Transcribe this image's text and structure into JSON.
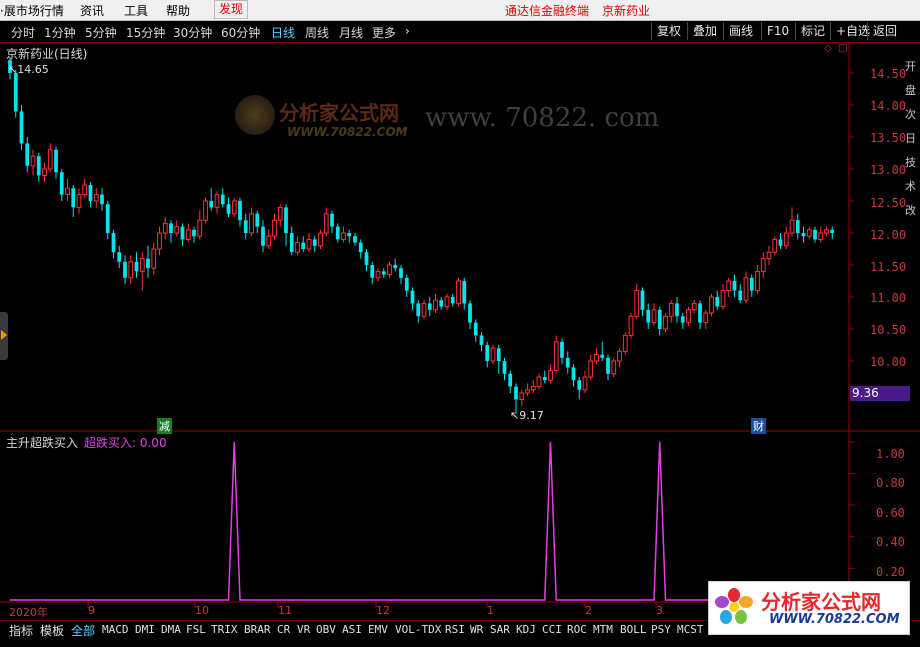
{
  "menubar": {
    "items": [
      "·展市场行情",
      "资讯",
      "工具",
      "帮助"
    ],
    "discover": "发现",
    "center_title": "通达信金融终端",
    "stock_title": "京新药业"
  },
  "toolbar": {
    "periods": [
      "分时",
      "1分钟",
      "5分钟",
      "15分钟",
      "30分钟",
      "60分钟",
      "日线",
      "周线",
      "月线",
      "更多",
      "›"
    ],
    "active_period": "日线",
    "right_buttons": [
      "复权",
      "叠加",
      "画线",
      "F10",
      "标记",
      "+自选",
      "返回"
    ]
  },
  "main_chart": {
    "stock_label": "京新药业(日线)",
    "high_marker": "14.65",
    "low_marker": "9.17",
    "current_price": "9.36",
    "badge_left": "减",
    "badge_right": "财",
    "side_text": "开 盘 次 日 技 术 改",
    "y_ticks": [
      "14.50",
      "14.00",
      "13.50",
      "13.00",
      "12.50",
      "12.00",
      "11.50",
      "11.00",
      "10.50",
      "10.00"
    ]
  },
  "watermark": {
    "logo_text": "分析家公式网",
    "logo_url": "WWW.70822.COM",
    "url_text": "www. 70822. com"
  },
  "indicator": {
    "name": "主升超跌买入",
    "series_label": "超跌买入: 0.00",
    "y_ticks": [
      "1.00",
      "0.80",
      "0.60",
      "0.40",
      "0.20"
    ]
  },
  "x_axis": {
    "labels": [
      "2020年",
      "9",
      "10",
      "11",
      "12",
      "1",
      "2",
      "3"
    ]
  },
  "bottom_tabs": {
    "items": [
      "指标",
      "模板",
      "全部",
      "MACD",
      "DMI",
      "DMA",
      "FSL",
      "TRIX",
      "BRAR",
      "CR",
      "VR",
      "OBV",
      "ASI",
      "EMV",
      "VOL-TDX",
      "RSI",
      "WR",
      "SAR",
      "KDJ",
      "CCI",
      "ROC",
      "MTM",
      "BOLL",
      "PSY",
      "MCST"
    ],
    "active": "全部"
  },
  "logo": {
    "title": "分析家公式网",
    "url": "WWW.70822.COM"
  },
  "chart_data": {
    "type": "candlestick",
    "y_range": [
      9.0,
      14.75
    ],
    "up_color": "#ff3232",
    "down_color": "#00e5ee",
    "candles": [
      [
        14.7,
        14.5,
        14.75,
        14.4
      ],
      [
        14.5,
        13.9,
        14.55,
        13.8
      ],
      [
        13.9,
        13.4,
        14.0,
        13.3
      ],
      [
        13.4,
        13.05,
        13.5,
        12.95
      ],
      [
        13.05,
        13.2,
        13.3,
        12.9
      ],
      [
        13.2,
        12.9,
        13.25,
        12.8
      ],
      [
        12.9,
        13.0,
        13.1,
        12.8
      ],
      [
        13.0,
        13.3,
        13.4,
        12.95
      ],
      [
        13.3,
        12.95,
        13.35,
        12.85
      ],
      [
        12.95,
        12.6,
        13.0,
        12.5
      ],
      [
        12.6,
        12.7,
        12.85,
        12.5
      ],
      [
        12.7,
        12.4,
        12.75,
        12.25
      ],
      [
        12.4,
        12.6,
        12.7,
        12.3
      ],
      [
        12.6,
        12.75,
        12.85,
        12.55
      ],
      [
        12.75,
        12.5,
        12.8,
        12.4
      ],
      [
        12.5,
        12.6,
        12.7,
        12.4
      ],
      [
        12.6,
        12.45,
        12.7,
        12.35
      ],
      [
        12.45,
        12.0,
        12.5,
        11.9
      ],
      [
        12.0,
        11.7,
        12.05,
        11.6
      ],
      [
        11.7,
        11.55,
        11.8,
        11.45
      ],
      [
        11.55,
        11.3,
        11.65,
        11.2
      ],
      [
        11.3,
        11.55,
        11.65,
        11.2
      ],
      [
        11.55,
        11.4,
        11.7,
        11.3
      ],
      [
        11.4,
        11.6,
        11.7,
        11.1
      ],
      [
        11.6,
        11.45,
        11.8,
        11.3
      ],
      [
        11.45,
        11.75,
        11.85,
        11.35
      ],
      [
        11.75,
        12.0,
        12.1,
        11.65
      ],
      [
        12.0,
        12.15,
        12.25,
        11.9
      ],
      [
        12.15,
        12.0,
        12.2,
        11.85
      ],
      [
        12.0,
        12.1,
        12.2,
        11.95
      ],
      [
        12.1,
        11.9,
        12.15,
        11.8
      ],
      [
        11.9,
        12.05,
        12.15,
        11.85
      ],
      [
        12.05,
        11.95,
        12.1,
        11.85
      ],
      [
        11.95,
        12.2,
        12.35,
        11.9
      ],
      [
        12.2,
        12.5,
        12.55,
        12.15
      ],
      [
        12.5,
        12.4,
        12.7,
        12.35
      ],
      [
        12.4,
        12.6,
        12.65,
        12.3
      ],
      [
        12.6,
        12.45,
        12.7,
        12.4
      ],
      [
        12.45,
        12.3,
        12.55,
        12.25
      ],
      [
        12.3,
        12.5,
        12.55,
        12.25
      ],
      [
        12.5,
        12.2,
        12.55,
        12.1
      ],
      [
        12.2,
        12.0,
        12.3,
        11.9
      ],
      [
        12.0,
        12.3,
        12.4,
        11.95
      ],
      [
        12.3,
        12.1,
        12.35,
        12.0
      ],
      [
        12.1,
        11.8,
        12.2,
        11.7
      ],
      [
        11.8,
        11.95,
        12.05,
        11.75
      ],
      [
        11.95,
        12.2,
        12.3,
        11.9
      ],
      [
        12.2,
        12.4,
        12.45,
        12.1
      ],
      [
        12.4,
        12.0,
        12.45,
        11.8
      ],
      [
        12.0,
        11.7,
        12.1,
        11.65
      ],
      [
        11.7,
        11.85,
        11.95,
        11.65
      ],
      [
        11.85,
        11.75,
        11.95,
        11.7
      ],
      [
        11.75,
        11.9,
        12.0,
        11.7
      ],
      [
        11.9,
        11.8,
        11.95,
        11.7
      ],
      [
        11.8,
        12.0,
        12.05,
        11.75
      ],
      [
        12.0,
        12.3,
        12.4,
        11.95
      ],
      [
        12.3,
        12.1,
        12.35,
        12.0
      ],
      [
        12.1,
        11.9,
        12.15,
        11.85
      ],
      [
        11.9,
        12.0,
        12.1,
        11.85
      ],
      [
        12.0,
        11.95,
        12.05,
        11.85
      ],
      [
        11.95,
        11.85,
        12.0,
        11.8
      ],
      [
        11.85,
        11.7,
        11.9,
        11.6
      ],
      [
        11.7,
        11.5,
        11.75,
        11.4
      ],
      [
        11.5,
        11.3,
        11.55,
        11.2
      ],
      [
        11.3,
        11.4,
        11.45,
        11.25
      ],
      [
        11.4,
        11.35,
        11.45,
        11.3
      ],
      [
        11.35,
        11.5,
        11.55,
        11.3
      ],
      [
        11.5,
        11.45,
        11.6,
        11.4
      ],
      [
        11.45,
        11.3,
        11.5,
        11.2
      ],
      [
        11.3,
        11.1,
        11.35,
        11.0
      ],
      [
        11.1,
        10.9,
        11.15,
        10.8
      ],
      [
        10.9,
        10.7,
        10.95,
        10.6
      ],
      [
        10.7,
        10.9,
        10.95,
        10.65
      ],
      [
        10.9,
        10.8,
        11.0,
        10.7
      ],
      [
        10.8,
        10.95,
        11.05,
        10.75
      ],
      [
        10.95,
        10.85,
        11.0,
        10.8
      ],
      [
        10.85,
        11.0,
        11.05,
        10.8
      ],
      [
        11.0,
        10.9,
        11.05,
        10.85
      ],
      [
        10.9,
        11.25,
        11.3,
        10.85
      ],
      [
        11.25,
        10.9,
        11.3,
        10.8
      ],
      [
        10.9,
        10.6,
        10.95,
        10.5
      ],
      [
        10.6,
        10.4,
        10.65,
        10.3
      ],
      [
        10.4,
        10.25,
        10.45,
        10.15
      ],
      [
        10.25,
        10.0,
        10.3,
        9.9
      ],
      [
        10.0,
        10.2,
        10.25,
        9.95
      ],
      [
        10.2,
        10.0,
        10.25,
        9.8
      ],
      [
        10.0,
        9.8,
        10.05,
        9.7
      ],
      [
        9.8,
        9.6,
        9.85,
        9.5
      ],
      [
        9.6,
        9.4,
        9.65,
        9.17
      ],
      [
        9.4,
        9.5,
        9.55,
        9.3
      ],
      [
        9.5,
        9.55,
        9.65,
        9.45
      ],
      [
        9.55,
        9.6,
        9.7,
        9.5
      ],
      [
        9.6,
        9.75,
        9.8,
        9.55
      ],
      [
        9.75,
        9.7,
        9.85,
        9.65
      ],
      [
        9.7,
        9.85,
        9.95,
        9.65
      ],
      [
        9.85,
        10.3,
        10.4,
        9.8
      ],
      [
        10.3,
        10.05,
        10.35,
        9.95
      ],
      [
        10.05,
        9.9,
        10.15,
        9.8
      ],
      [
        9.9,
        9.7,
        9.95,
        9.6
      ],
      [
        9.7,
        9.55,
        9.75,
        9.4
      ],
      [
        9.55,
        9.75,
        9.85,
        9.5
      ],
      [
        9.75,
        10.0,
        10.1,
        9.7
      ],
      [
        10.0,
        10.1,
        10.2,
        9.95
      ],
      [
        10.1,
        10.05,
        10.3,
        10.0
      ],
      [
        10.05,
        9.8,
        10.1,
        9.7
      ],
      [
        9.8,
        10.0,
        10.05,
        9.75
      ],
      [
        10.0,
        10.15,
        10.2,
        9.9
      ],
      [
        10.15,
        10.4,
        10.45,
        10.1
      ],
      [
        10.4,
        10.7,
        10.75,
        10.35
      ],
      [
        10.7,
        11.1,
        11.2,
        10.65
      ],
      [
        11.1,
        10.8,
        11.15,
        10.7
      ],
      [
        10.8,
        10.6,
        10.9,
        10.5
      ],
      [
        10.6,
        10.8,
        10.9,
        10.55
      ],
      [
        10.8,
        10.5,
        10.85,
        10.4
      ],
      [
        10.5,
        10.7,
        10.75,
        10.45
      ],
      [
        10.7,
        10.9,
        10.95,
        10.6
      ],
      [
        10.9,
        10.7,
        11.0,
        10.6
      ],
      [
        10.7,
        10.6,
        10.75,
        10.5
      ],
      [
        10.6,
        10.8,
        10.85,
        10.55
      ],
      [
        10.8,
        10.9,
        10.95,
        10.75
      ],
      [
        10.9,
        10.6,
        10.95,
        10.5
      ],
      [
        10.6,
        10.75,
        10.8,
        10.5
      ],
      [
        10.75,
        11.0,
        11.05,
        10.7
      ],
      [
        11.0,
        10.85,
        11.1,
        10.8
      ],
      [
        10.85,
        11.1,
        11.2,
        10.8
      ],
      [
        11.1,
        11.25,
        11.3,
        11.0
      ],
      [
        11.25,
        11.1,
        11.35,
        11.0
      ],
      [
        11.1,
        10.95,
        11.2,
        10.9
      ],
      [
        10.95,
        11.3,
        11.4,
        10.9
      ],
      [
        11.3,
        11.1,
        11.35,
        11.0
      ],
      [
        11.1,
        11.4,
        11.5,
        11.05
      ],
      [
        11.4,
        11.6,
        11.7,
        11.3
      ],
      [
        11.6,
        11.7,
        11.8,
        11.5
      ],
      [
        11.7,
        11.9,
        11.95,
        11.65
      ],
      [
        11.9,
        11.8,
        12.0,
        11.75
      ],
      [
        11.8,
        12.0,
        12.1,
        11.75
      ],
      [
        12.0,
        12.2,
        12.4,
        11.95
      ],
      [
        12.2,
        12.0,
        12.3,
        11.9
      ],
      [
        12.0,
        11.95,
        12.1,
        11.85
      ],
      [
        11.95,
        12.05,
        12.1,
        11.9
      ],
      [
        12.05,
        11.9,
        12.1,
        11.85
      ],
      [
        11.9,
        12.0,
        12.1,
        11.85
      ],
      [
        12.0,
        12.05,
        12.1,
        11.95
      ],
      [
        12.05,
        12.0,
        12.1,
        11.9
      ]
    ],
    "indicator": {
      "name": "超跌买入",
      "y_range": [
        0,
        1.05
      ],
      "signals_at_index": [
        39,
        94,
        113
      ]
    }
  }
}
